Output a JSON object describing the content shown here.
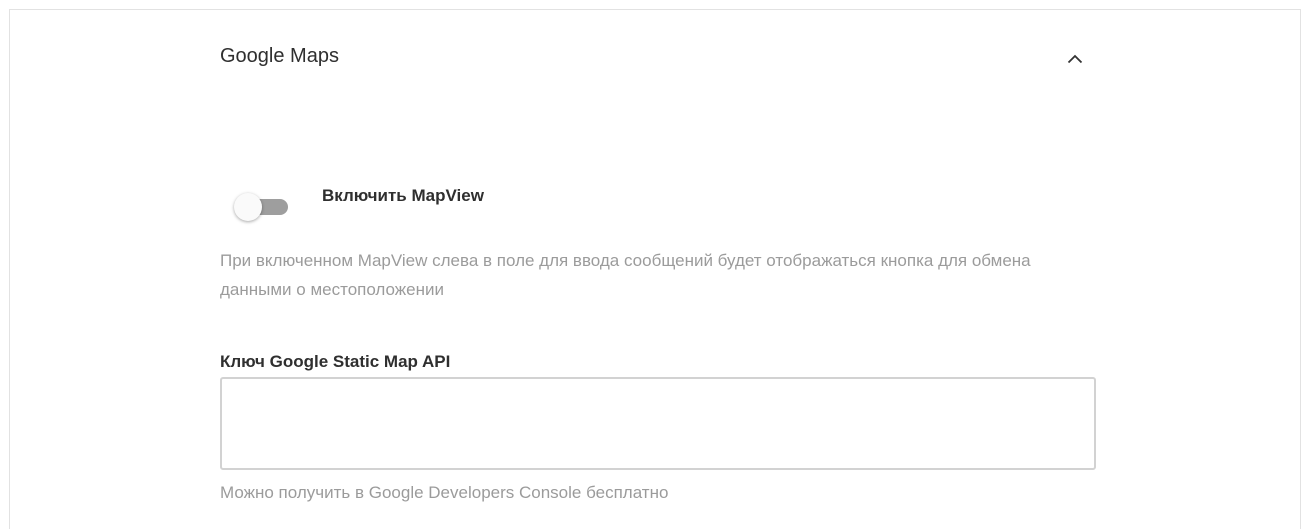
{
  "section": {
    "title": "Google Maps",
    "collapse_icon": "chevron-up-icon"
  },
  "mapview_toggle": {
    "label": "Включить MapView",
    "enabled": false,
    "description": "При включенном MapView слева в поле для ввода сообщений будет отображаться кнопка для обмена данными о местоположении"
  },
  "static_map_api_key": {
    "label": "Ключ Google Static Map API",
    "value": "",
    "placeholder": "",
    "help": "Можно получить в Google Developers Console бесплатно"
  },
  "colors": {
    "toggle_track": "#9e9e9e",
    "toggle_knob": "#fafafa",
    "muted_text": "#9b9b9b",
    "input_border": "#d2d2d2"
  }
}
